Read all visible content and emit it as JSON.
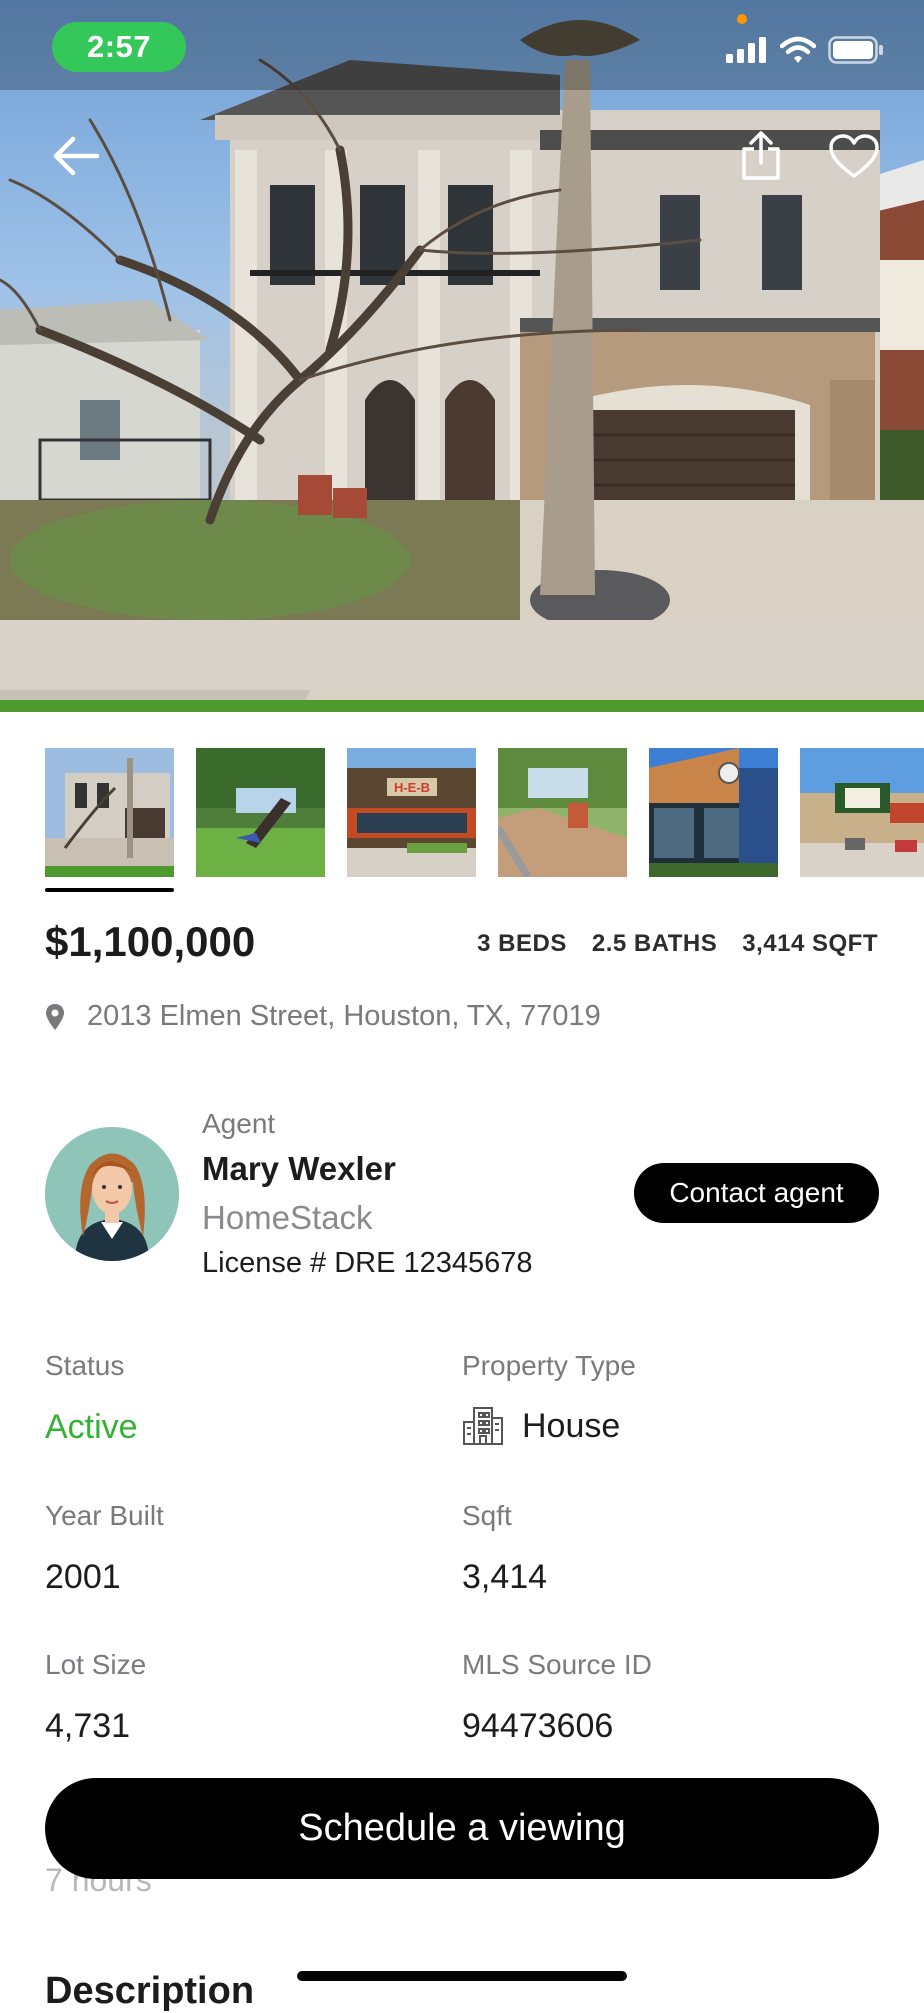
{
  "status_bar": {
    "time": "2:57"
  },
  "hero": {
    "icons": [
      "back-arrow-icon",
      "share-icon",
      "heart-icon"
    ]
  },
  "thumbnails": [
    "house-front",
    "park-sculpture",
    "heb-store",
    "playground",
    "shop-front",
    "whole-foods"
  ],
  "listing": {
    "price": "$1,100,000",
    "beds": "3 BEDS",
    "baths": "2.5 BATHS",
    "sqft": "3,414 SQFT",
    "address": "2013 Elmen Street, Houston, TX, 77019"
  },
  "agent": {
    "caption": "Agent",
    "name": "Mary Wexler",
    "company": "HomeStack",
    "license": "License # DRE  12345678",
    "contact_label": "Contact agent"
  },
  "details": {
    "status": {
      "label": "Status",
      "value": "Active"
    },
    "property_type": {
      "label": "Property Type",
      "value": "House"
    },
    "year_built": {
      "label": "Year Built",
      "value": "2001"
    },
    "sqft": {
      "label": "Sqft",
      "value": "3,414"
    },
    "lot_size": {
      "label": "Lot Size",
      "value": "4,731"
    },
    "mls_id": {
      "label": "MLS Source ID",
      "value": "94473606"
    }
  },
  "partial_text": "7 hours",
  "schedule_label": "Schedule a viewing",
  "description_heading": "Description",
  "colors": {
    "accent_green": "#34c759",
    "active_green": "#34b233",
    "button_black": "#000000"
  }
}
